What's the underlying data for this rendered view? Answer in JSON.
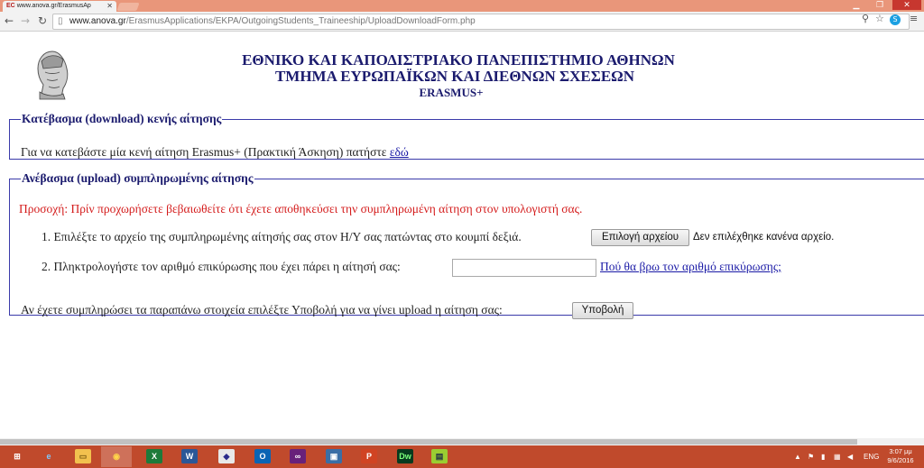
{
  "browser": {
    "tab_title": "www.anova.gr/ErasmusAp",
    "tab_favicon": "EC",
    "url_host": "www.anova.gr",
    "url_path": "/ErasmusApplications/EKPA/OutgoingStudents_Traineeship/UploadDownloadForm.php",
    "icons": [
      "back-arrow-icon",
      "forward-arrow-icon",
      "reload-icon",
      "page-icon",
      "zoom-icon",
      "star-icon",
      "skype-icon",
      "menu-icon"
    ]
  },
  "header": {
    "line1": "ΕΘΝΙΚΟ ΚΑΙ ΚΑΠΟΔΙΣΤΡΙΑΚΟ ΠΑΝΕΠΙΣΤΗΜΙΟ ΑΘΗΝΩΝ",
    "line2": "ΤΜΗΜΑ ΕΥΡΩΠΑΪΚΩΝ ΚΑΙ ΔΙΕΘΝΩΝ ΣΧΕΣΕΩΝ",
    "line3": "ERASMUS+"
  },
  "download": {
    "legend": "Κατέβασμα (download) κενής αίτησης",
    "text": "Για να κατεβάστε μία κενή αίτηση Erasmus+ (Πρακτική Άσκηση) πατήστε",
    "link": "εδώ"
  },
  "upload": {
    "legend": "Ανέβασμα (upload) συμπληρωμένης αίτησης",
    "warning": "Προσοχή: Πρίν προχωρήσετε βεβαιωθείτε ότι έχετε αποθηκεύσει την συμπληρωμένη αίτηση στον υπολογιστή σας.",
    "step1": "1. Επιλέξτε το αρχείο της συμπληρωμένης αίτησής σας στον Η/Υ σας πατώντας στο κουμπί δεξιά.",
    "file_button": "Επιλογή αρχείου",
    "no_file": "Δεν επιλέχθηκε κανένα αρχείο.",
    "step2": "2. Πληκτρολογήστε τον αριθμό επικύρωσης που έχει πάρει η αίτησή σας:",
    "code_value": "",
    "help_link": "Πού θα βρω τον αριθμό επικύρωσης;",
    "submit_text": "Αν έχετε συμπληρώσει τα παραπάνω στοιχεία επιλέξτε Υποβολή για να γίνει upload η αίτηση σας:",
    "submit_button": "Υποβολή"
  },
  "taskbar": {
    "apps": [
      {
        "name": "start-icon",
        "label": "⊞"
      },
      {
        "name": "internet-explorer-icon",
        "label": "e"
      },
      {
        "name": "file-explorer-icon",
        "label": "▭"
      },
      {
        "name": "chrome-icon",
        "label": "◉"
      },
      {
        "name": "excel-icon",
        "label": "X"
      },
      {
        "name": "word-icon",
        "label": "W"
      },
      {
        "name": "app-diamond-icon",
        "label": "◆"
      },
      {
        "name": "outlook-icon",
        "label": "O"
      },
      {
        "name": "visual-studio-icon",
        "label": "∞"
      },
      {
        "name": "remote-desktop-icon",
        "label": "▣"
      },
      {
        "name": "powerpoint-icon",
        "label": "P"
      },
      {
        "name": "dreamweaver-icon",
        "label": "Dw"
      },
      {
        "name": "notepad-icon",
        "label": "▤"
      }
    ],
    "language": "ENG",
    "time": "3:07 μμ",
    "date": "9/6/2016"
  }
}
